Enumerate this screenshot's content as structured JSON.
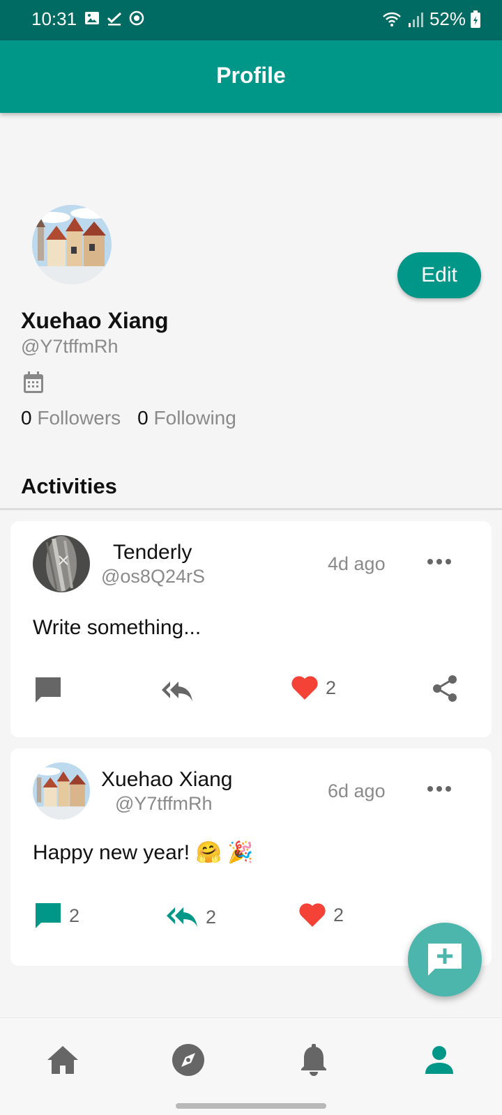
{
  "status_bar": {
    "time": "10:31",
    "battery": "52%",
    "left_icons": [
      "gallery-icon",
      "check-icon",
      "sync-icon"
    ],
    "right_icons": [
      "wifi-icon",
      "signal-icon",
      "battery-icon"
    ]
  },
  "app_bar": {
    "title": "Profile"
  },
  "profile": {
    "name": "Xuehao Xiang",
    "handle": "@Y7tffmRh",
    "edit_label": "Edit",
    "followers_count": "0",
    "followers_label": "Followers",
    "following_count": "0",
    "following_label": "Following"
  },
  "activities": {
    "title": "Activities",
    "posts": [
      {
        "author": "Tenderly",
        "handle": "@os8Q24rS",
        "time": "4d ago",
        "text": "Write something...",
        "comments": "",
        "reposts": "",
        "likes": "2"
      },
      {
        "author": "Xuehao Xiang",
        "handle": "@Y7tffmRh",
        "time": "6d ago",
        "text": "Happy new year! 🤗 🎉",
        "comments": "2",
        "reposts": "2",
        "likes": "2"
      }
    ]
  },
  "bottom_nav": {
    "items": [
      "home-icon",
      "explore-icon",
      "notifications-icon",
      "profile-icon"
    ],
    "active": "profile-icon"
  },
  "colors": {
    "primary": "#009688",
    "status_bar": "#006b63",
    "fab": "#4db6ac",
    "heart": "#f44336",
    "secondary_text": "#8a8a8a"
  }
}
